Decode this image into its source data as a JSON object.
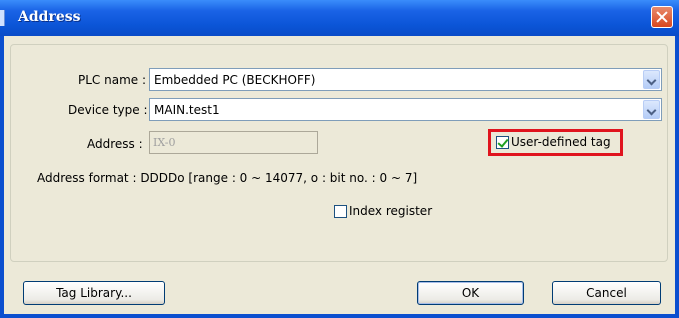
{
  "window": {
    "title": "Address"
  },
  "form": {
    "plc_name_label": "PLC name :",
    "plc_name_value": "Embedded PC (BECKHOFF)",
    "device_type_label": "Device type :",
    "device_type_value": "MAIN.test1",
    "address_label": "Address :",
    "address_value": "IX-0",
    "user_defined_tag_label": "User-defined tag",
    "user_defined_tag_checked": true,
    "address_format": "Address format : DDDDo [range : 0 ~ 14077, o : bit no. : 0 ~ 7]",
    "index_register_label": "Index register",
    "index_register_checked": false
  },
  "buttons": {
    "tag_library": "Tag Library...",
    "ok": "OK",
    "cancel": "Cancel"
  },
  "colors": {
    "title_bar": "#0b55d7",
    "dialog_bg": "#ece9d8",
    "highlight": "#e0141e"
  }
}
